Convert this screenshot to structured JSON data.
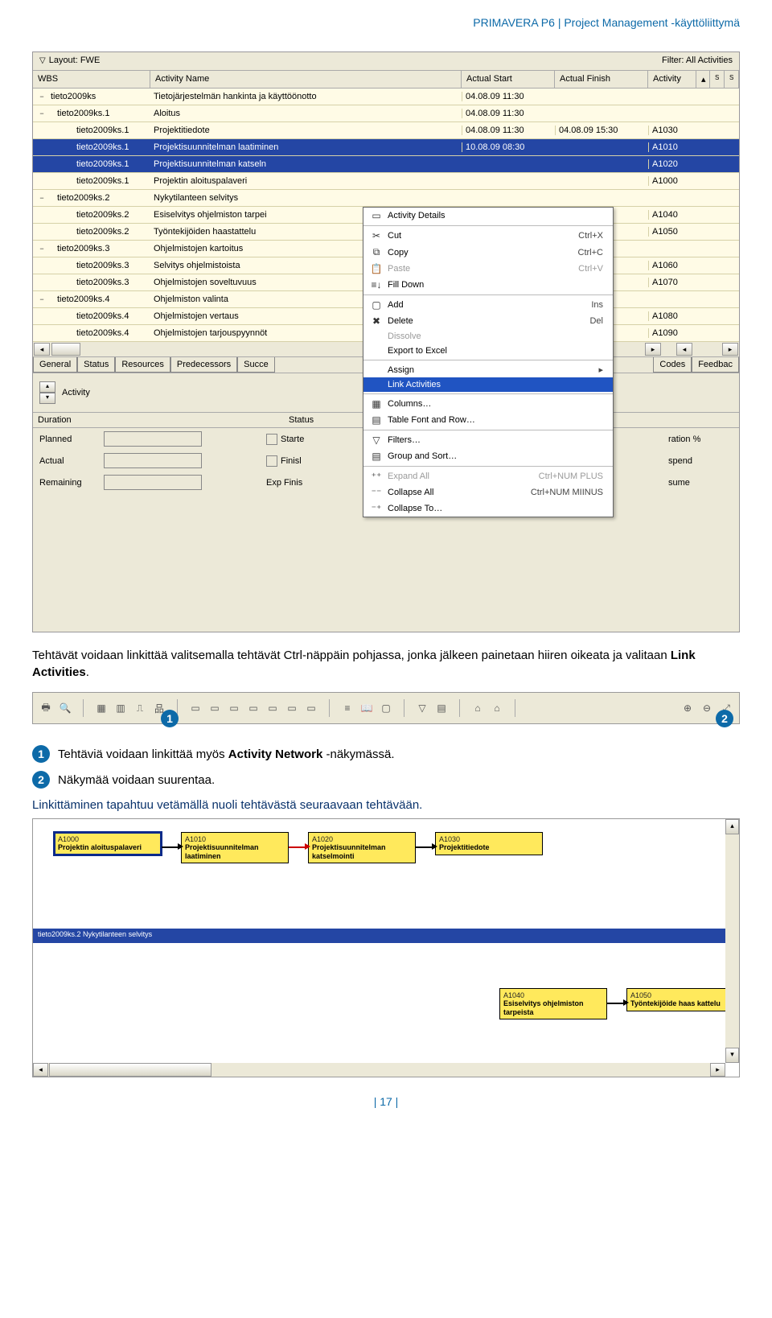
{
  "header": "PRIMAVERA P6 | Project Management -käyttöliittymä",
  "layout": {
    "label": "Layout: FWE",
    "filter": "Filter: All Activities"
  },
  "columns": {
    "wbs": "WBS",
    "name": "Activity Name",
    "as": "Actual Start",
    "af": "Actual Finish",
    "act": "Activity",
    "s1": "S",
    "s2": "S"
  },
  "rows": [
    {
      "toggle": "−",
      "wbs": "tieto2009ks",
      "name": "Tietojärjestelmän hankinta ja käyttöönotto",
      "as": "04.08.09 11:30",
      "af": "",
      "act": "",
      "cls": ""
    },
    {
      "toggle": "−",
      "wbs": "tieto2009ks.1",
      "name": "Aloitus",
      "as": "04.08.09 11:30",
      "af": "",
      "act": "",
      "cls": "indent1"
    },
    {
      "toggle": "",
      "wbs": "tieto2009ks.1",
      "name": "Projektitiedote",
      "as": "04.08.09 11:30",
      "af": "04.08.09 15:30",
      "act": "A1030",
      "cls": "indent2"
    },
    {
      "toggle": "",
      "wbs": "tieto2009ks.1",
      "name": "Projektisuunnitelman laatiminen",
      "as": "10.08.09 08:30",
      "af": "",
      "act": "A1010",
      "cls": "indent2 selected"
    },
    {
      "toggle": "",
      "wbs": "tieto2009ks.1",
      "name": "Projektisuunnitelman katseln",
      "as": "",
      "af": "",
      "act": "A1020",
      "cls": "indent2 selected"
    },
    {
      "toggle": "",
      "wbs": "tieto2009ks.1",
      "name": "Projektin aloituspalaveri",
      "as": "",
      "af": "",
      "act": "A1000",
      "cls": "indent2"
    },
    {
      "toggle": "−",
      "wbs": "tieto2009ks.2",
      "name": "Nykytilanteen selvitys",
      "as": "",
      "af": "",
      "act": "",
      "cls": "indent1"
    },
    {
      "toggle": "",
      "wbs": "tieto2009ks.2",
      "name": "Esiselvitys ohjelmiston tarpei",
      "as": "",
      "af": "",
      "act": "A1040",
      "cls": "indent2"
    },
    {
      "toggle": "",
      "wbs": "tieto2009ks.2",
      "name": "Työntekijöiden haastattelu",
      "as": "",
      "af": "",
      "act": "A1050",
      "cls": "indent2"
    },
    {
      "toggle": "−",
      "wbs": "tieto2009ks.3",
      "name": "Ohjelmistojen kartoitus",
      "as": "",
      "af": "",
      "act": "",
      "cls": "indent1"
    },
    {
      "toggle": "",
      "wbs": "tieto2009ks.3",
      "name": "Selvitys ohjelmistoista",
      "as": "",
      "af": "",
      "act": "A1060",
      "cls": "indent2"
    },
    {
      "toggle": "",
      "wbs": "tieto2009ks.3",
      "name": "Ohjelmistojen soveltuvuus",
      "as": "",
      "af": "",
      "act": "A1070",
      "cls": "indent2"
    },
    {
      "toggle": "−",
      "wbs": "tieto2009ks.4",
      "name": "Ohjelmiston valinta",
      "as": "",
      "af": "",
      "act": "",
      "cls": "indent1"
    },
    {
      "toggle": "",
      "wbs": "tieto2009ks.4",
      "name": "Ohjelmistojen vertaus",
      "as": "",
      "af": "",
      "act": "A1080",
      "cls": "indent2"
    },
    {
      "toggle": "",
      "wbs": "tieto2009ks.4",
      "name": "Ohjelmistojen tarjouspyynnöt",
      "as": "",
      "af": "",
      "act": "A1090",
      "cls": "indent2"
    }
  ],
  "tabs": [
    "General",
    "Status",
    "Resources",
    "Predecessors",
    "Succe",
    "s",
    "Codes",
    "Feedbac"
  ],
  "form": {
    "activity": "Activity",
    "duration": "Duration",
    "status": "Status",
    "planned": "Planned",
    "start": "Starte",
    "rpct": "ration %",
    "actual": "Actual",
    "finish": "Finisl",
    "spend": "spend",
    "remaining": "Remaining",
    "exp": "Exp Finis",
    "sume": "sume"
  },
  "ctx": {
    "details": "Activity Details",
    "cut": "Cut",
    "cut_s": "Ctrl+X",
    "copy": "Copy",
    "copy_s": "Ctrl+C",
    "paste": "Paste",
    "paste_s": "Ctrl+V",
    "fill": "Fill Down",
    "add": "Add",
    "add_s": "Ins",
    "del": "Delete",
    "del_s": "Del",
    "dissolve": "Dissolve",
    "export": "Export to Excel",
    "assign": "Assign",
    "link": "Link Activities",
    "cols": "Columns…",
    "font": "Table Font and Row…",
    "filters": "Filters…",
    "group": "Group and Sort…",
    "expand": "Expand All",
    "expand_s": "Ctrl+NUM PLUS",
    "collapse": "Collapse All",
    "collapse_s": "Ctrl+NUM MIINUS",
    "collapseto": "Collapse To…"
  },
  "caption1": {
    "t1": "Tehtävät voidaan linkittää valitsemalla tehtävät Ctrl-näppäin pohjassa, jonka jälkeen painetaan hiiren oikeata ja valitaan ",
    "t2": "Link Activities",
    "t3": "."
  },
  "badges": {
    "one": "1",
    "two": "2"
  },
  "callouts": {
    "one_a": "Tehtäviä voidaan linkittää myös ",
    "one_b": "Activity Network",
    "one_c": " -näkymässä.",
    "two": "Näkymää voidaan suurentaa."
  },
  "link_caption": "Linkittäminen tapahtuu vetämällä nuoli tehtävästä seuraavaan tehtävään.",
  "net": {
    "n1": {
      "id": "A1000",
      "nm": "Projektin aloituspalaveri"
    },
    "n2": {
      "id": "A1010",
      "nm": "Projektisuunnitelman laatiminen"
    },
    "n3": {
      "id": "A1020",
      "nm": "Projektisuunnitelman katselmointi"
    },
    "n4": {
      "id": "A1030",
      "nm": "Projektitiedote"
    },
    "band": "tieto2009ks.2  Nykytilanteen selvitys",
    "n5": {
      "id": "A1040",
      "nm": "Esiselvitys ohjelmiston tarpeista"
    },
    "n6": {
      "id": "A1050",
      "nm": "Työntekijöide haas kattelu"
    }
  },
  "page": "| 17 |"
}
